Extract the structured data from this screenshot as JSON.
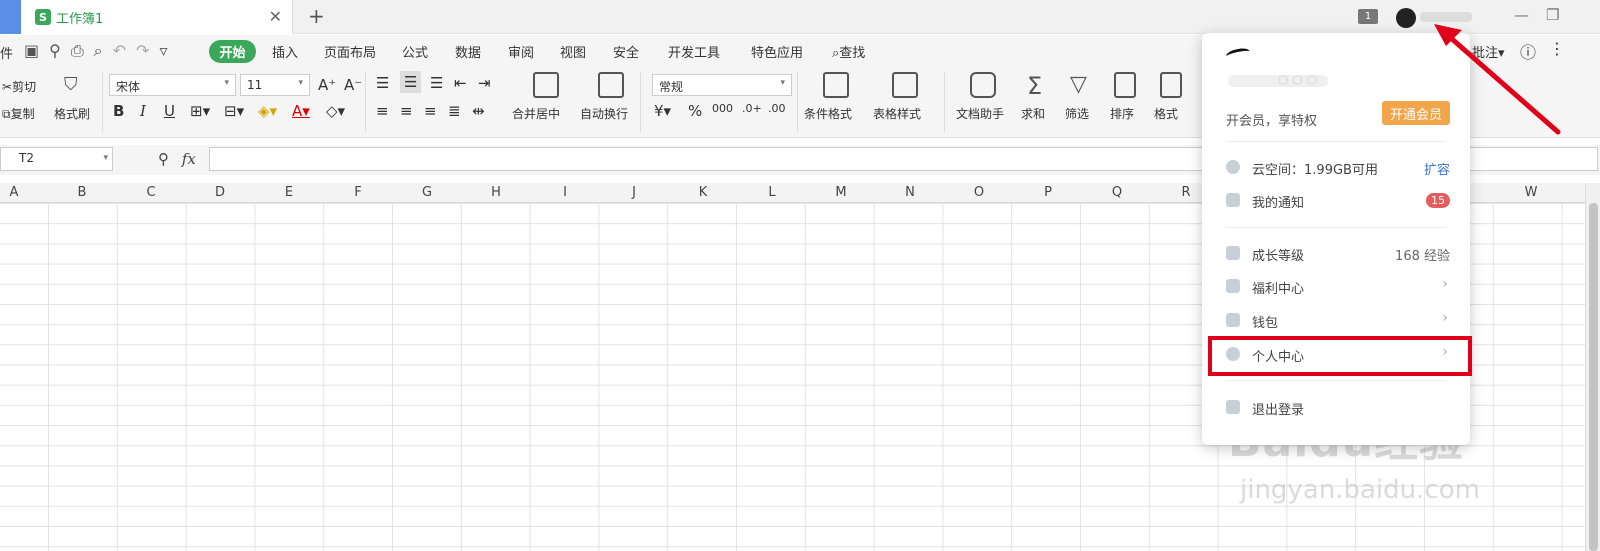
{
  "titlebar": {
    "tab_icon_letter": "S",
    "tab_title": "工作簿1",
    "tab_close": "✕",
    "tab_add": "+",
    "notif_count": "1",
    "win_minimize": "—",
    "win_restore": "❐"
  },
  "menubar": {
    "left_edge": "件",
    "items": [
      "开始",
      "插入",
      "页面布局",
      "公式",
      "数据",
      "审阅",
      "视图",
      "安全",
      "开发工具",
      "特色应用",
      "查找"
    ],
    "active_index": 0,
    "right_partial": "批注",
    "right_partial_caret": "▾"
  },
  "ribbon": {
    "cut": "剪切",
    "copy": "复制",
    "format_painter": "格式刷",
    "font_name": "宋体",
    "font_size": "11",
    "bold": "B",
    "italic": "I",
    "underline": "U",
    "merge_center": "合并居中",
    "auto_wrap": "自动换行",
    "number_format": "常规",
    "cond_format": "条件格式",
    "table_style": "表格样式",
    "doc_helper": "文档助手",
    "sum": "求和",
    "filter": "筛选",
    "sort": "排序",
    "format": "格式"
  },
  "formulabar": {
    "cell_ref": "T2",
    "fx": "fx"
  },
  "columns": [
    "A",
    "B",
    "C",
    "D",
    "E",
    "F",
    "G",
    "H",
    "I",
    "J",
    "K",
    "L",
    "M",
    "N",
    "O",
    "P",
    "Q",
    "R",
    "W"
  ],
  "dropdown": {
    "member_text": "开会员，享特权",
    "vip_button": "开通会员",
    "cloud_label": "云空间：",
    "cloud_value": "1.99GB可用",
    "cloud_action": "扩容",
    "notify_label": "我的通知",
    "notify_count": "15",
    "level_label": "成长等级",
    "level_value": "168 经验",
    "welfare_label": "福利中心",
    "wallet_label": "钱包",
    "profile_label": "个人中心",
    "logout_label": "退出登录",
    "chevron": "›"
  },
  "watermark": {
    "main": "Baidu经验",
    "sub": "jingyan.baidu.com"
  },
  "colors": {
    "accent_green": "#3aa75b",
    "vip_orange": "#f3a54c",
    "highlight_red": "#e0001a",
    "badge_red": "#e65b5b",
    "link_blue": "#3c74d7"
  }
}
